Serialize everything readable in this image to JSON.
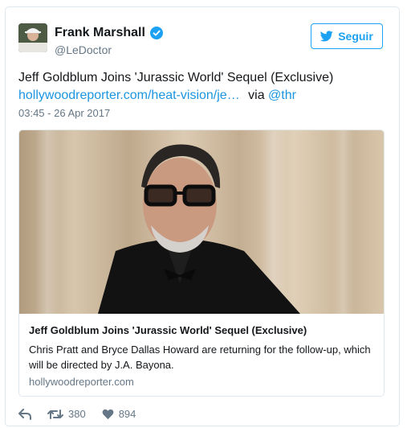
{
  "author": {
    "name": "Frank Marshall",
    "handle": "@LeDoctor"
  },
  "follow_label": "Seguir",
  "tweet": {
    "text": "Jeff Goldblum Joins 'Jurassic World' Sequel (Exclusive)",
    "link": "hollywoodreporter.com/heat-vision/je…",
    "via": "via",
    "mention": "@thr",
    "timestamp": "03:45 - 26 Apr 2017"
  },
  "card": {
    "title": "Jeff Goldblum Joins 'Jurassic World' Sequel (Exclusive)",
    "description": "Chris Pratt and Bryce Dallas Howard are returning for the follow-up, which will be directed by J.A. Bayona.",
    "domain": "hollywoodreporter.com"
  },
  "actions": {
    "retweets": "380",
    "likes": "894"
  },
  "colors": {
    "accent": "#1da1f2",
    "link": "#1b95e0",
    "muted": "#657786"
  },
  "icons": [
    "verified-icon",
    "twitter-bird-icon",
    "reply-icon",
    "retweet-icon",
    "heart-icon"
  ]
}
